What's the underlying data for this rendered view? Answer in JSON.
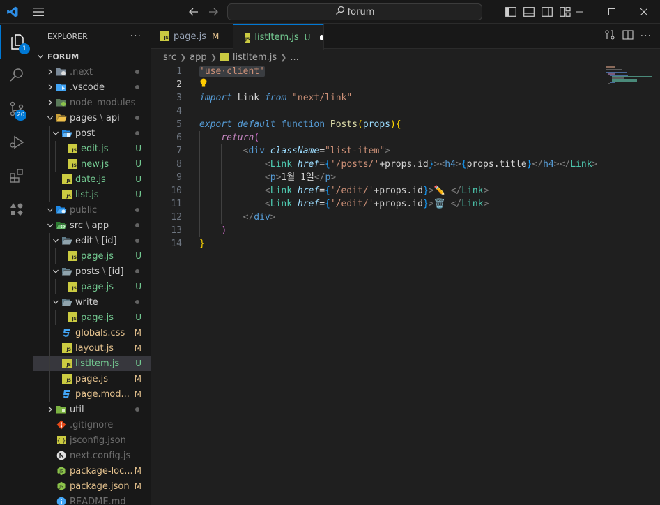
{
  "titlebar": {
    "command_center": "forum",
    "menu_icon": "hamburger-menu-icon"
  },
  "activity": {
    "explorer_badge": "1",
    "scm_badge": "20"
  },
  "explorer": {
    "title": "EXPLORER",
    "more": "···",
    "root": "FORUM",
    "items": [
      {
        "name": ".next",
        "status": "",
        "dot": true
      },
      {
        "name": ".vscode",
        "status": "",
        "dot": true
      },
      {
        "name": "node_modules",
        "status": "",
        "dot": false
      },
      {
        "name": "pages",
        "name2": "api",
        "status": "",
        "dot": true
      },
      {
        "name": "post",
        "status": "",
        "dot": true
      },
      {
        "name": "edit.js",
        "status": "U"
      },
      {
        "name": "new.js",
        "status": "U"
      },
      {
        "name": "date.js",
        "status": "U"
      },
      {
        "name": "list.js",
        "status": "U"
      },
      {
        "name": "public",
        "status": "",
        "dot": true
      },
      {
        "name": "src",
        "name2": "app",
        "status": "",
        "dot": true
      },
      {
        "name": "edit",
        "name2": "[id]",
        "status": "",
        "dot": true
      },
      {
        "name": "page.js",
        "status": "U"
      },
      {
        "name": "posts",
        "name2": "[id]",
        "status": "",
        "dot": true
      },
      {
        "name": "page.js",
        "status": "U"
      },
      {
        "name": "write",
        "status": "",
        "dot": true
      },
      {
        "name": "page.js",
        "status": "U"
      },
      {
        "name": "globals.css",
        "status": "M"
      },
      {
        "name": "layout.js",
        "status": "M"
      },
      {
        "name": "listItem.js",
        "status": "U"
      },
      {
        "name": "page.js",
        "status": "M"
      },
      {
        "name": "page.mod...",
        "status": "M"
      },
      {
        "name": "util",
        "status": "",
        "dot": true
      },
      {
        "name": ".gitignore",
        "status": ""
      },
      {
        "name": "jsconfig.json",
        "status": ""
      },
      {
        "name": "next.config.js",
        "status": ""
      },
      {
        "name": "package-loc...",
        "status": "M"
      },
      {
        "name": "package.json",
        "status": "M"
      },
      {
        "name": "README.md",
        "status": ""
      }
    ]
  },
  "tabs": [
    {
      "label": "page.js",
      "status": "M"
    },
    {
      "label": "listItem.js",
      "status": "U"
    }
  ],
  "breadcrumb": {
    "parts": [
      "src",
      "app",
      "listItem.js",
      "..."
    ]
  },
  "editor": {
    "line_numbers": [
      "1",
      "2",
      "3",
      "4",
      "5",
      "6",
      "7",
      "8",
      "9",
      "10",
      "11",
      "12",
      "13",
      "14"
    ]
  },
  "colors": {
    "accent": "#0078d4",
    "untracked": "#73c991",
    "modified": "#e2c08d",
    "js_icon": "#cbcb41"
  }
}
